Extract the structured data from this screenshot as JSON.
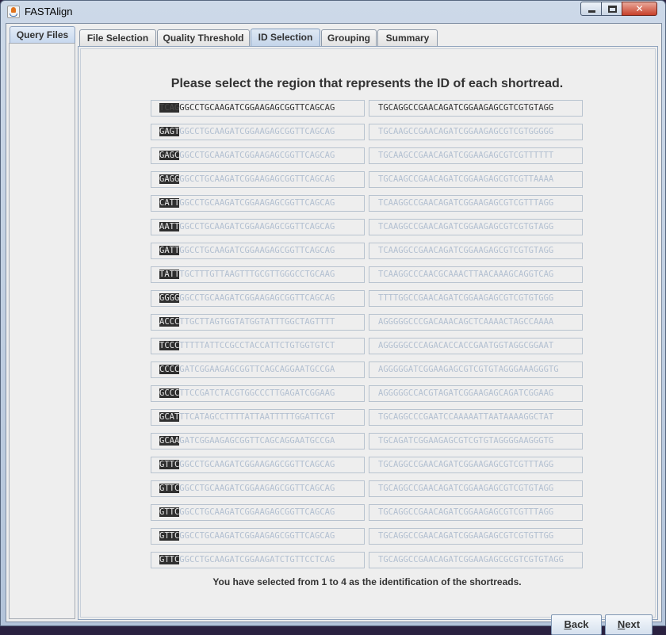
{
  "window": {
    "title": "FASTAlign",
    "minimize_label": "",
    "close_label": "✕"
  },
  "left_tab": {
    "label": "Query Files"
  },
  "tabs": [
    {
      "label": "File Selection"
    },
    {
      "label": "Quality Threshold"
    },
    {
      "label": "ID Selection"
    },
    {
      "label": "Grouping"
    },
    {
      "label": "Summary"
    }
  ],
  "heading": "Please select the region that represents the ID of each shortread.",
  "rows": [
    {
      "id": "TCAG",
      "left_rest": "GGCCTGCAAGATCGGAAGAGCGGTTCAGCAG",
      "right": "TGCAGGCCGAACAGATCGGAAGAGCGTCGTGTAGG"
    },
    {
      "id": "GAGT",
      "left_rest": "GGCCTGCAAGATCGGAAGAGCGGTTCAGCAG",
      "right": "TGCAAGCCGAACAGATCGGAAGAGCGTCGTGGGGG"
    },
    {
      "id": "GAGC",
      "left_rest": "GGCCTGCAAGATCGGAAGAGCGGTTCAGCAG",
      "right": "TGCAAGCCGAACAGATCGGAAGAGCGTCGTTTTTT"
    },
    {
      "id": "GAGG",
      "left_rest": "GGCCTGCAAGATCGGAAGAGCGGTTCAGCAG",
      "right": "TGCAAGCCGAACAGATCGGAAGAGCGTCGTTAAAA"
    },
    {
      "id": "CATT",
      "left_rest": "GGCCTGCAAGATCGGAAGAGCGGTTCAGCAG",
      "right": "TCAAGGCCGAACAGATCGGAAGAGCGTCGTTTAGG"
    },
    {
      "id": "AATT",
      "left_rest": "GGCCTGCAAGATCGGAAGAGCGGTTCAGCAG",
      "right": "TCAAGGCCGAACAGATCGGAAGAGCGTCGTGTAGG"
    },
    {
      "id": "GATT",
      "left_rest": "GGCCTGCAAGATCGGAAGAGCGGTTCAGCAG",
      "right": "TCAAGGCCGAACAGATCGGAAGAGCGTCGTGTAGG"
    },
    {
      "id": "TATT",
      "left_rest": "TGCTTTGTTAAGTTTGCGTTGGGCCTGCAAG",
      "right": "TCAAGGCCCAACGCAAACTTAACAAAGCAGGTCAG"
    },
    {
      "id": "GGGG",
      "left_rest": "GGCCTGCAAGATCGGAAGAGCGGTTCAGCAG",
      "right": "TTTTGGCCGAACAGATCGGAAGAGCGTCGTGTGGG"
    },
    {
      "id": "ACCC",
      "left_rest": "TTGCTTAGTGGTATGGTATTTGGCTAGTTTT",
      "right": "AGGGGGCCCGACAAACAGCTCAAAACTAGCCAAAA"
    },
    {
      "id": "TCCC",
      "left_rest": "TTTTTATTCCGCCTACCATTCTGTGGTGTCT",
      "right": "AGGGGGCCCAGACACCACCGAATGGTAGGCGGAAT"
    },
    {
      "id": "CCCC",
      "left_rest": "GATCGGAAGAGCGGTTCAGCAGGAATGCCGA",
      "right": "AGGGGGATCGGAAGAGCGTCGTGTAGGGAAAGGGTG"
    },
    {
      "id": "GCCC",
      "left_rest": "TTCCGATCTACGTGGCCCTTGAGATCGGAAG",
      "right": "AGGGGGCCACGTAGATCGGAAGAGCAGATCGGAAG"
    },
    {
      "id": "GCAT",
      "left_rest": "TTCATAGCCTTTTATTAATTTTTGGATTCGT",
      "right": "TGCAGGCCCGAATCCAAAAATTAATAAAAGGCTAT"
    },
    {
      "id": "GCAA",
      "left_rest": "GATCGGAAGAGCGGTTCAGCAGGAATGCCGA",
      "right": "TGCAGATCGGAAGAGCGTCGTGTAGGGGAAGGGTG"
    },
    {
      "id": "GTTC",
      "left_rest": "GGCCTGCAAGATCGGAAGAGCGGTTCAGCAG",
      "right": "TGCAGGCCGAACAGATCGGAAGAGCGTCGTTTAGG"
    },
    {
      "id": "GTTC",
      "left_rest": "GGCCTGCAAGATCGGAAGAGCGGTTCAGCAG",
      "right": "TGCAGGCCGAACAGATCGGAAGAGCGTCGTGTAGG"
    },
    {
      "id": "GTTC",
      "left_rest": "GGCCTGCAAGATCGGAAGAGCGGTTCAGCAG",
      "right": "TGCAGGCCGAACAGATCGGAAGAGCGTCGTTTAGG"
    },
    {
      "id": "GTTC",
      "left_rest": "GGCCTGCAAGATCGGAAGAGCGGTTCAGCAG",
      "right": "TGCAGGCCGAACAGATCGGAAGAGCGTCGTGTTGG"
    },
    {
      "id": "GTTC",
      "left_rest": "GGCCTGCAAGATCGGAAGATCTGTTCCTCAG",
      "right": "TGCAGGCCGAACAGATCGGAAGAGCGCGTCGTGTAGG"
    }
  ],
  "status": "You have selected from 1 to 4 as the identification of the shortreads.",
  "buttons": {
    "back": {
      "mnemonic": "B",
      "rest": "ack"
    },
    "next": {
      "mnemonic": "N",
      "rest": "ext"
    }
  }
}
